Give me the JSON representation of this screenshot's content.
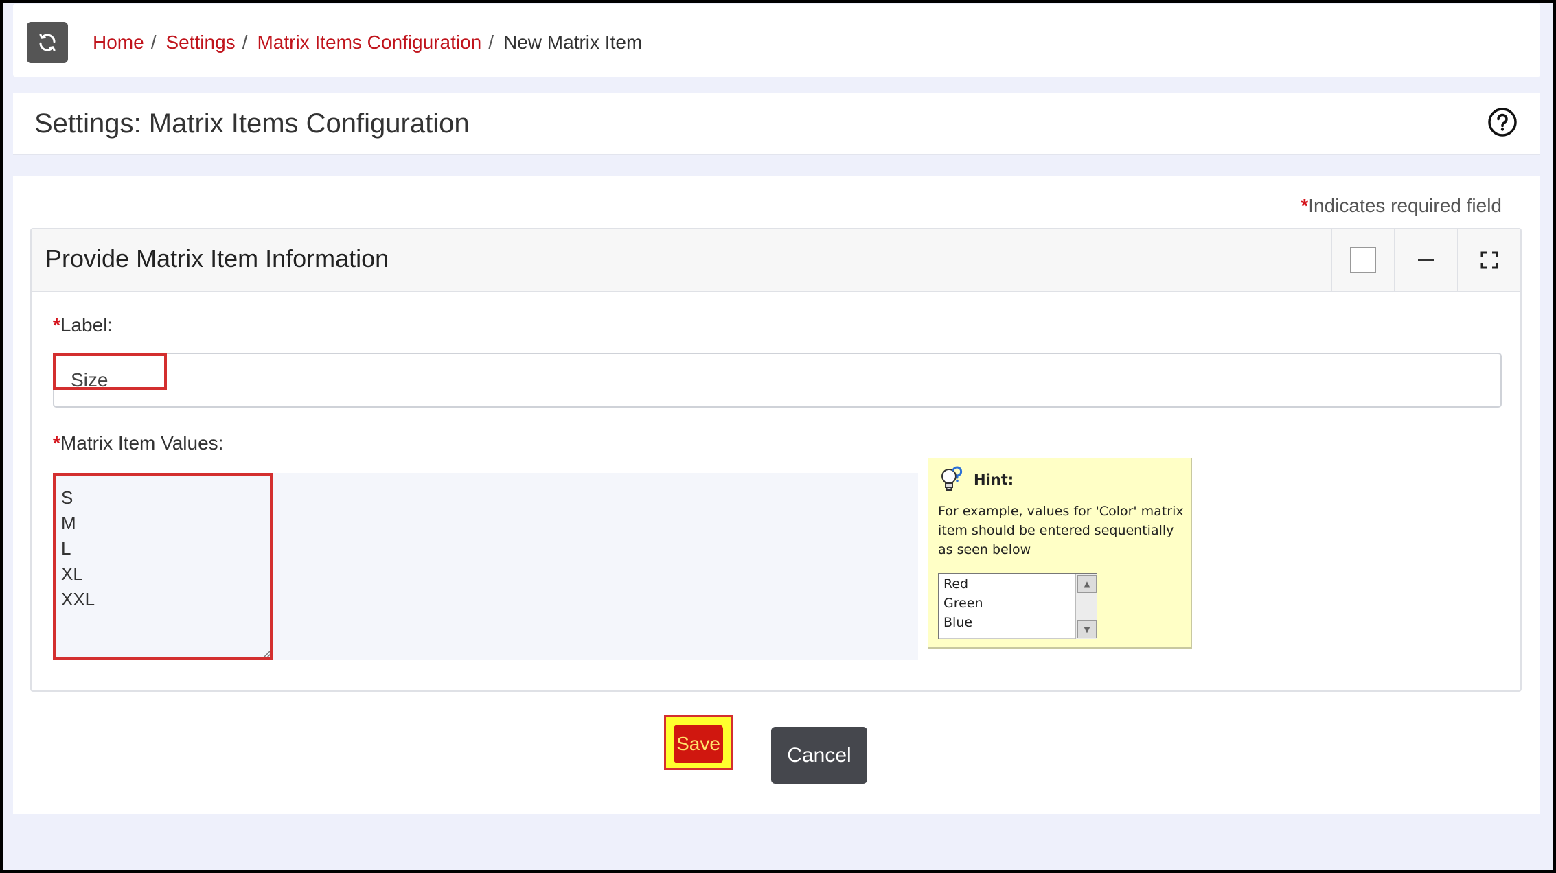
{
  "breadcrumb": {
    "items": [
      "Home",
      "Settings",
      "Matrix Items Configuration"
    ],
    "separator": "/",
    "current": "New Matrix Item"
  },
  "page": {
    "title": "Settings: Matrix Items Configuration"
  },
  "form": {
    "required_star": "*",
    "required_note": "Indicates required field",
    "card_title": "Provide Matrix Item Information",
    "label_field": {
      "label": "Label:",
      "value": "Size"
    },
    "values_field": {
      "label": "Matrix Item Values:",
      "value": "S\nM\nL\nXL\nXXL"
    }
  },
  "hint": {
    "title": "Hint:",
    "body": "For example, values for 'Color' matrix item should be entered sequentially as seen below",
    "options": [
      "Red",
      "Green",
      "Blue"
    ]
  },
  "actions": {
    "save": "Save",
    "cancel": "Cancel"
  },
  "icons": {
    "refresh": "refresh-icon",
    "help": "help-icon",
    "select_all": "checkbox-icon",
    "collapse": "minimize-icon",
    "fullscreen": "expand-icon",
    "hint": "lightbulb-question-icon"
  },
  "colors": {
    "link": "#c0141c",
    "save_button": "#d0170f",
    "save_text": "#ffe36a",
    "highlight_fill": "#ffff2e",
    "highlight_border": "#d32f2f",
    "cancel_button": "#45474d",
    "hint_background": "#ffffc6"
  }
}
